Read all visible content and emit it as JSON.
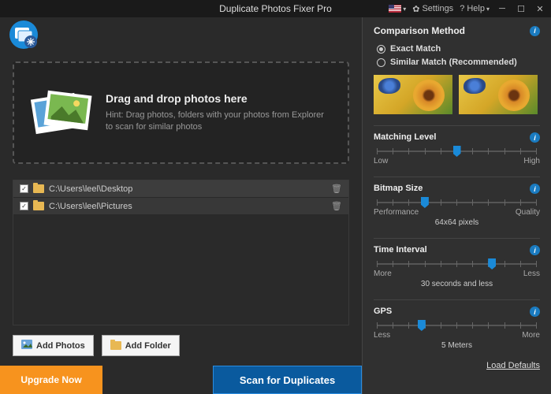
{
  "titlebar": {
    "title": "Duplicate Photos Fixer Pro",
    "settings": "Settings",
    "help": "? Help"
  },
  "dropzone": {
    "title": "Drag and drop photos here",
    "hint": "Hint: Drag photos, folders with your photos from Explorer to scan for similar photos"
  },
  "folders": [
    {
      "path": "C:\\Users\\leel\\Desktop"
    },
    {
      "path": "C:\\Users\\leel\\Pictures"
    }
  ],
  "buttons": {
    "add_photos": "Add Photos",
    "add_folder": "Add Folder",
    "upgrade": "Upgrade Now",
    "scan": "Scan for Duplicates"
  },
  "comparison": {
    "title": "Comparison Method",
    "exact": "Exact Match",
    "similar": "Similar Match (Recommended)"
  },
  "sliders": {
    "matching": {
      "label": "Matching Level",
      "left": "Low",
      "right": "High",
      "pos": 50
    },
    "bitmap": {
      "label": "Bitmap Size",
      "left": "Performance",
      "right": "Quality",
      "mid": "64x64 pixels",
      "pos": 30
    },
    "time": {
      "label": "Time Interval",
      "left": "More",
      "right": "Less",
      "mid": "30 seconds and less",
      "pos": 72
    },
    "gps": {
      "label": "GPS",
      "left": "Less",
      "right": "More",
      "mid": "5 Meters",
      "pos": 28
    }
  },
  "load_defaults": "Load Defaults"
}
